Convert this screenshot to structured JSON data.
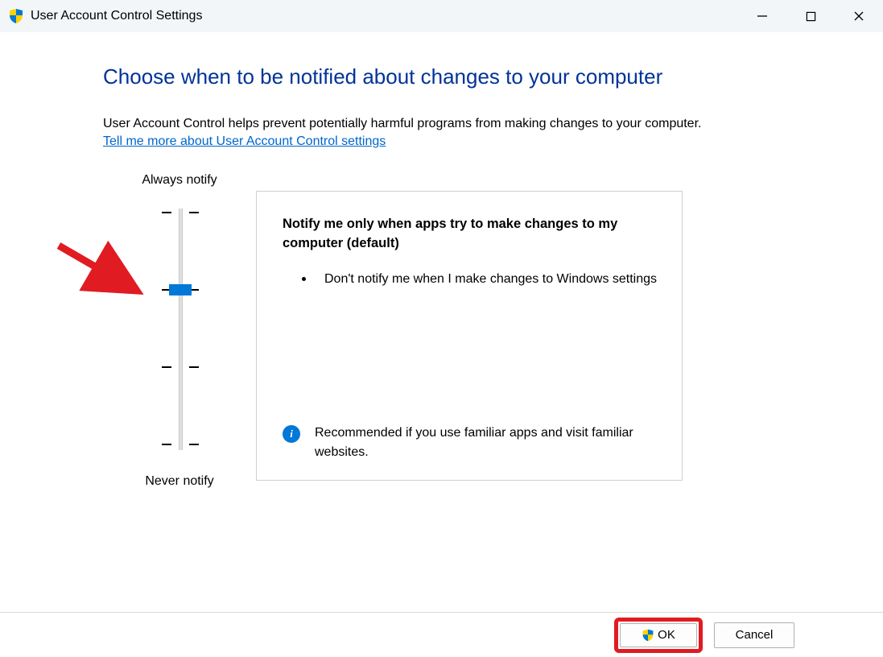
{
  "window": {
    "title": "User Account Control Settings"
  },
  "heading": "Choose when to be notified about changes to your computer",
  "intro_text": "User Account Control helps prevent potentially harmful programs from making changes to your computer.",
  "link_text": "Tell me more about User Account Control settings",
  "slider": {
    "top_label": "Always notify",
    "bottom_label": "Never notify"
  },
  "panel": {
    "title": "Notify me only when apps try to make changes to my computer (default)",
    "bullet1": "Don't notify me when I make changes to Windows settings",
    "recommend": "Recommended if you use familiar apps and visit familiar websites."
  },
  "buttons": {
    "ok": "OK",
    "cancel": "Cancel"
  }
}
